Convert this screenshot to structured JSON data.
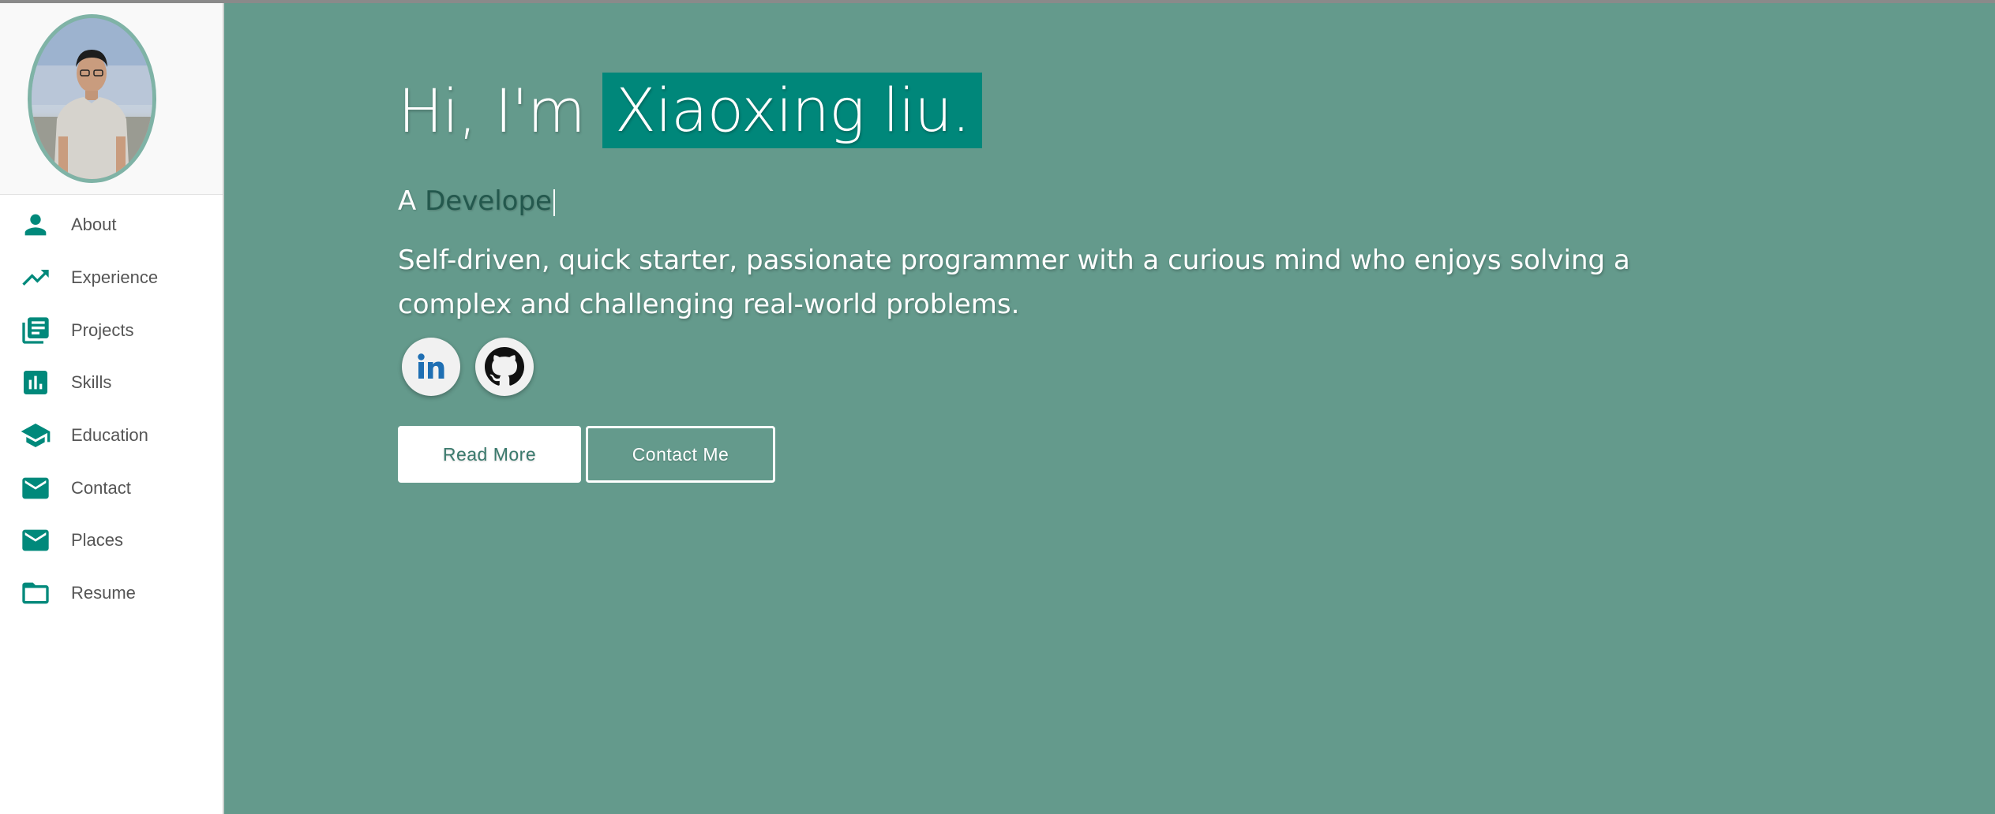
{
  "sidebar": {
    "items": [
      {
        "label": "About",
        "icon": "person-icon"
      },
      {
        "label": "Experience",
        "icon": "trending-up-icon"
      },
      {
        "label": "Projects",
        "icon": "library-books-icon"
      },
      {
        "label": "Skills",
        "icon": "bar-chart-icon"
      },
      {
        "label": "Education",
        "icon": "school-icon"
      },
      {
        "label": "Contact",
        "icon": "mail-icon"
      },
      {
        "label": "Places",
        "icon": "mail-icon"
      },
      {
        "label": "Resume",
        "icon": "folder-icon"
      }
    ]
  },
  "hero": {
    "greeting_prefix": "Hi, I'm",
    "name": "Xiaoxing liu.",
    "role_prefix": "A",
    "role_typed": "Develope",
    "tagline": "Self-driven, quick starter, passionate programmer with a curious mind who enjoys solving a complex and challenging real-world problems.",
    "socials": [
      {
        "name": "linkedin",
        "icon": "linkedin-icon"
      },
      {
        "name": "github",
        "icon": "github-icon"
      }
    ],
    "read_more_label": "Read More",
    "contact_label": "Contact Me"
  },
  "colors": {
    "background": "#649a8c",
    "accent": "#00877a",
    "sidebar_icon": "#00897b",
    "role_typed": "#23584d"
  }
}
